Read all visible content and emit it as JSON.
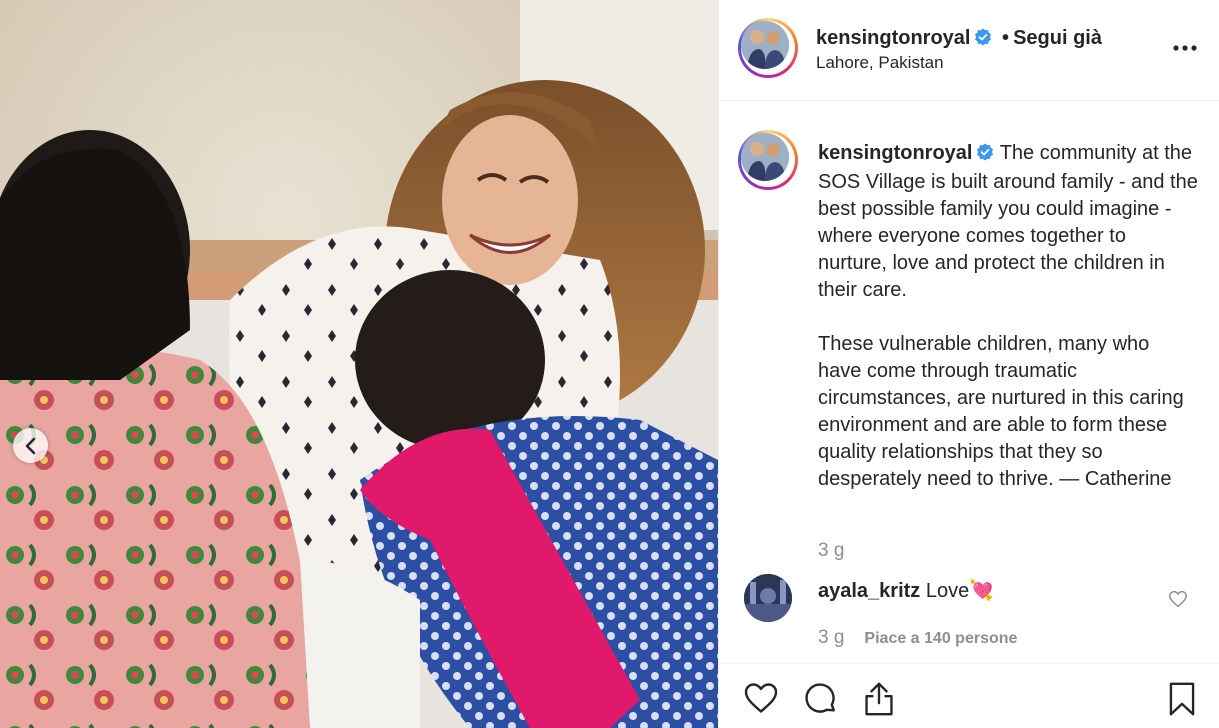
{
  "post": {
    "username": "kensingtonroyal",
    "follow_state": "Segui già",
    "separator": "•",
    "location": "Lahore, Pakistan"
  },
  "caption": {
    "username": "kensingtonroyal",
    "paragraph1": "The community at the SOS Village is built around family - and the best possible family you could imagine - where everyone comes together to nurture, love and protect the children in their care.",
    "paragraph2": "These vulnerable children, many who have come through traumatic circumstances, are nurtured in this caring environment and are able to form these quality relationships that they so desperately need to thrive. — Catherine",
    "time": "3 g"
  },
  "comment": {
    "username": "ayala_kritz",
    "text": "Love",
    "emoji": "💘",
    "time": "3 g",
    "likes": "Piace a 140 persone"
  },
  "icons": {
    "verified": "verified-badge-icon",
    "more": "more-options-icon",
    "carousel_prev": "chevron-left-icon",
    "like": "heart-icon",
    "comment": "comment-icon",
    "share": "share-icon",
    "save": "bookmark-icon"
  },
  "colors": {
    "text": "#262626",
    "muted": "#8e8e8e",
    "verified": "#3897f0",
    "border": "#efefef"
  }
}
